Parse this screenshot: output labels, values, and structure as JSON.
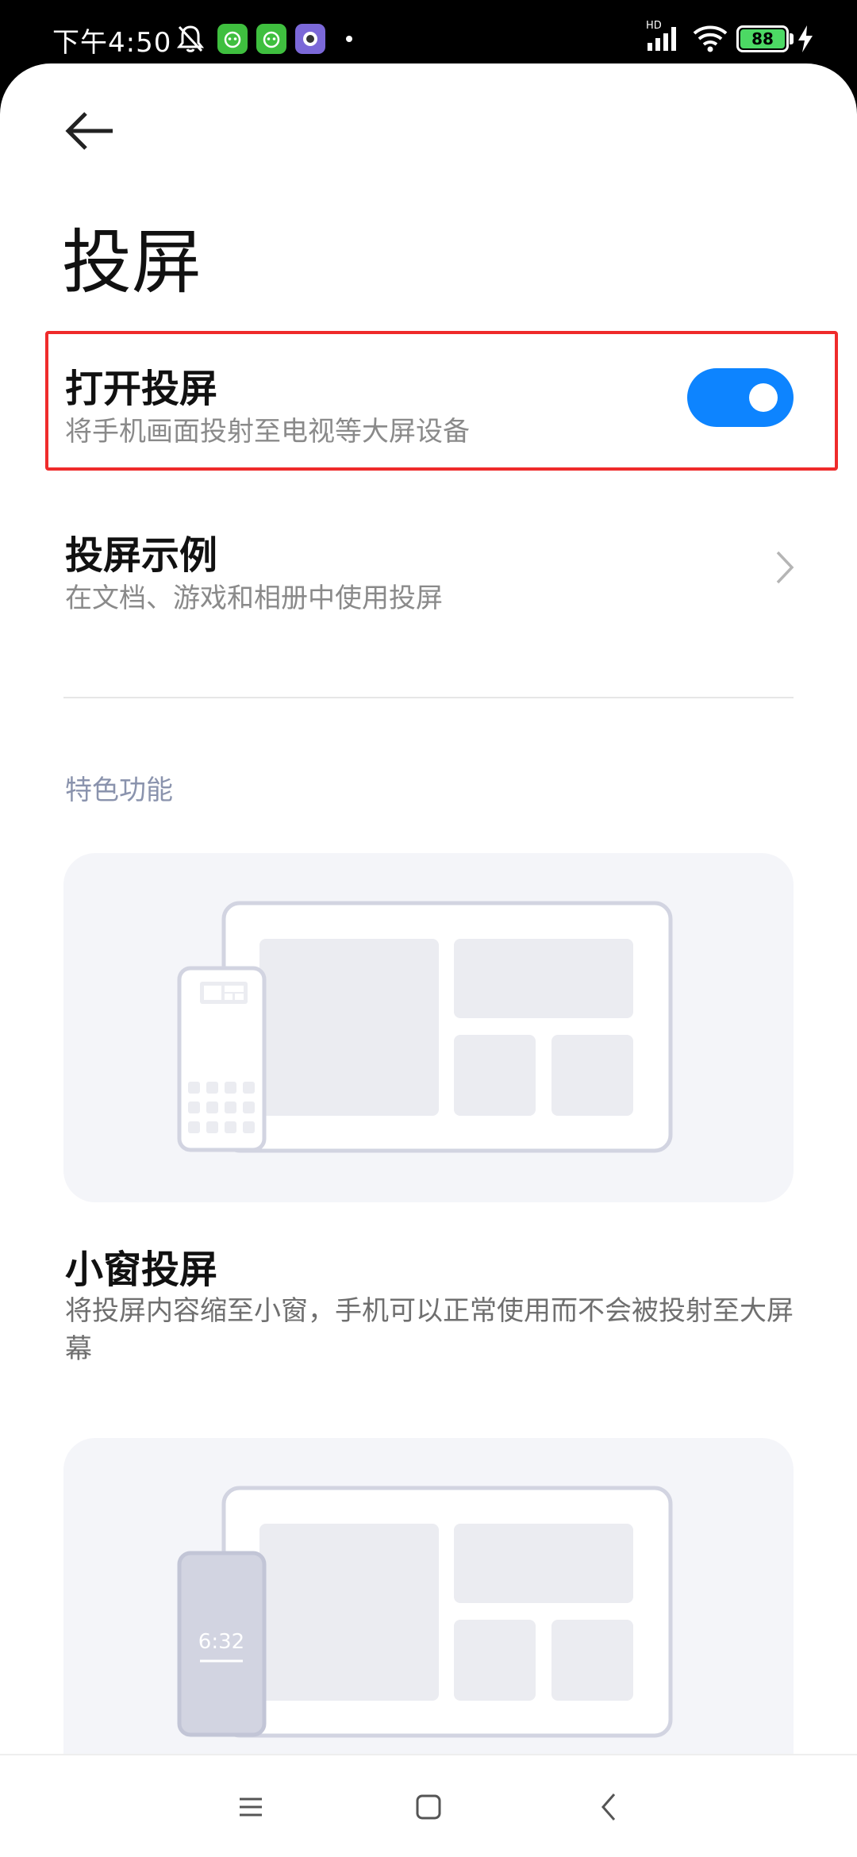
{
  "status_bar": {
    "time": "下午4:50",
    "network": "HD",
    "battery": "88",
    "icons": [
      "mute-bell-icon",
      "app-icon-green-1",
      "app-icon-green-2",
      "app-icon-purple",
      "signal-icon",
      "wifi-icon",
      "battery-icon",
      "charging-icon"
    ]
  },
  "header": {
    "back_icon": "back-arrow-icon",
    "title": "投屏"
  },
  "settings": {
    "cast_toggle": {
      "title": "打开投屏",
      "subtitle": "将手机画面投射至电视等大屏设备",
      "enabled": true
    },
    "cast_examples": {
      "title": "投屏示例",
      "subtitle": "在文档、游戏和相册中使用投屏"
    }
  },
  "features": {
    "section_label": "特色功能",
    "items": [
      {
        "title": "小窗投屏",
        "description": "将投屏内容缩至小窗，手机可以正常使用而不会被投射至大屏幕"
      },
      {
        "phone_time": "6:32"
      }
    ]
  },
  "nav_bar": {
    "icons": [
      "menu-icon",
      "home-icon",
      "back-icon"
    ]
  },
  "colors": {
    "accent": "#0d84ff",
    "highlight_border": "#ef2b2b",
    "section_label": "#8a93ad"
  }
}
